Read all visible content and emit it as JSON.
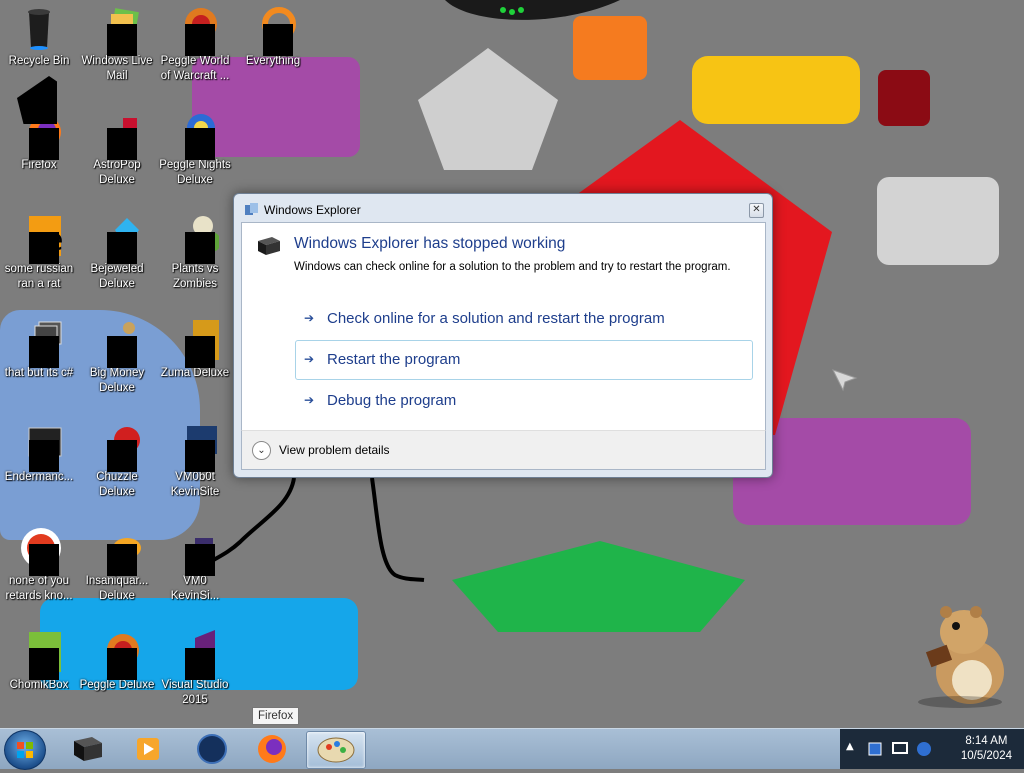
{
  "desktop": {
    "icons": [
      {
        "label": "Recycle Bin",
        "icon": "recycle-bin-icon"
      },
      {
        "label": "Windows Live\nMail",
        "icon": "mail-icon"
      },
      {
        "label": "Peggle World\nof Warcraft ...",
        "icon": "peggle-icon"
      },
      {
        "label": "Everything",
        "icon": "search-icon"
      },
      {
        "label": "Firefox",
        "icon": "firefox-icon"
      },
      {
        "label": "AstroPop\nDeluxe",
        "icon": "game-icon"
      },
      {
        "label": "Peggle Nights\nDeluxe",
        "icon": "peggle-icon"
      },
      {
        "label": "some russian\nran a rat",
        "icon": "file-icon"
      },
      {
        "label": "Bejeweled\nDeluxe",
        "icon": "gem-icon"
      },
      {
        "label": "Plants vs\nZombies",
        "icon": "plant-icon"
      },
      {
        "label": "that but its c#",
        "icon": "file-icon"
      },
      {
        "label": "Big Money\nDeluxe",
        "icon": "money-icon"
      },
      {
        "label": "Zuma Deluxe",
        "icon": "game-icon"
      },
      {
        "label": "Endermanc...",
        "icon": "app-icon"
      },
      {
        "label": "Chuzzle\nDeluxe",
        "icon": "game-icon"
      },
      {
        "label": "VM0b0t\nKevinSite",
        "icon": "app-icon"
      },
      {
        "label": "none of you\nretards kno...",
        "icon": "file-icon"
      },
      {
        "label": "Insaniquar...\nDeluxe",
        "icon": "fish-icon"
      },
      {
        "label": "VM0\nKevinSi...",
        "icon": "app-icon"
      },
      {
        "label": "ChomikBox",
        "icon": "app-icon"
      },
      {
        "label": "Peggle Deluxe",
        "icon": "peggle-icon"
      },
      {
        "label": "Visual Studio\n2015",
        "icon": "visual-studio-icon"
      }
    ]
  },
  "dialog": {
    "title": "Windows Explorer",
    "main_instruction": "Windows Explorer has stopped working",
    "content": "Windows can check online for a solution to the problem and try to restart the program.",
    "commands": [
      {
        "label": "Check online for a solution and restart the program"
      },
      {
        "label": "Restart the program"
      },
      {
        "label": "Debug the program"
      }
    ],
    "details_label": "View problem details"
  },
  "taskbar": {
    "tooltip": "Firefox",
    "clock_time": "8:14 AM",
    "clock_date": "10/5/2024",
    "apps": [
      "terminal-icon",
      "media-player-icon",
      "globe-icon",
      "firefox-icon",
      "paint-icon"
    ]
  },
  "colors": {
    "desktop_bg": "#7d7d7d",
    "dialog_link": "#1e3e8c",
    "selection_border": "#a8d3e8"
  }
}
